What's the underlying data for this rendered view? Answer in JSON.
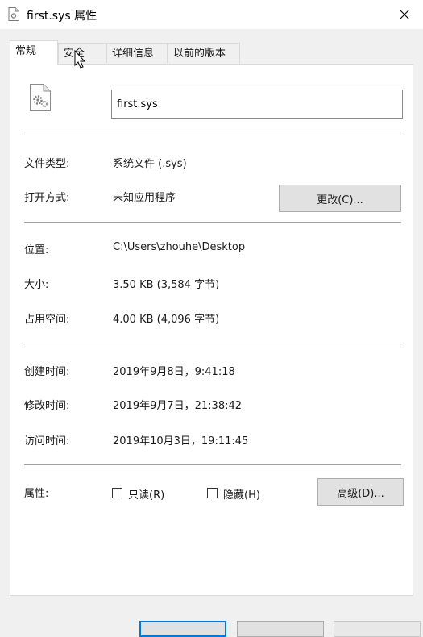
{
  "window": {
    "title": "first.sys 属性",
    "close_glyph": "✕"
  },
  "tabs": [
    {
      "label": "常规"
    },
    {
      "label": "安全"
    },
    {
      "label": "详细信息"
    },
    {
      "label": "以前的版本"
    }
  ],
  "general": {
    "filename": "first.sys",
    "file_type": {
      "label": "文件类型:",
      "value": "系统文件 (.sys)"
    },
    "opens_with": {
      "label": "打开方式:",
      "value": "未知应用程序",
      "button": "更改(C)..."
    },
    "location": {
      "label": "位置:",
      "value": "C:\\Users\\zhouhe\\Desktop"
    },
    "size": {
      "label": "大小:",
      "value": "3.50 KB (3,584 字节)"
    },
    "size_on_disk": {
      "label": "占用空间:",
      "value": "4.00 KB (4,096 字节)"
    },
    "created": {
      "label": "创建时间:",
      "value": "2019年9月8日，9:41:18"
    },
    "modified": {
      "label": "修改时间:",
      "value": "2019年9月7日，21:38:42"
    },
    "accessed": {
      "label": "访问时间:",
      "value": "2019年10月3日，19:11:45"
    },
    "attributes": {
      "label": "属性:",
      "readonly": "只读(R)",
      "hidden": "隐藏(H)",
      "advanced_button": "高级(D)..."
    }
  },
  "colors": {
    "accent": "#0078d7",
    "panel": "#ffffff",
    "dialog_bg": "#f0f0f0"
  }
}
